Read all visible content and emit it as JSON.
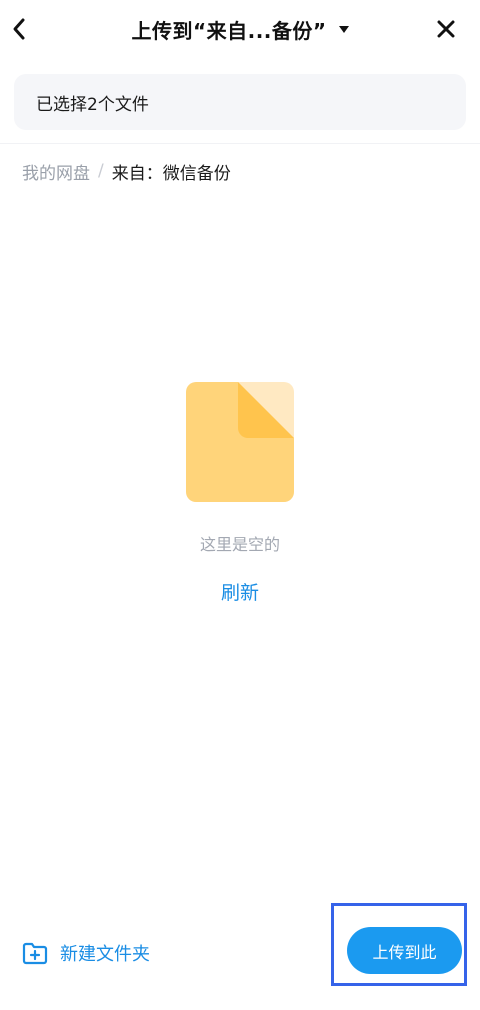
{
  "header": {
    "title": "上传到“来自...备份”",
    "back_icon": "chevron-left-icon",
    "caret_icon": "caret-down-icon",
    "close_icon": "close-icon"
  },
  "selection": {
    "text": "已选择2个文件"
  },
  "breadcrumb": {
    "root": "我的网盘",
    "separator": "/",
    "current": "来自：微信备份"
  },
  "empty_state": {
    "illustration_icon": "empty-file-icon",
    "message": "这里是空的",
    "refresh_label": "刷新"
  },
  "footer": {
    "new_folder_icon": "folder-add-icon",
    "new_folder_label": "新建文件夹",
    "upload_label": "上传到此"
  },
  "colors": {
    "accent": "#1a8de4",
    "button": "#1b9af0",
    "highlight_frame": "#3563e9",
    "file_body": "#ffd47a",
    "file_corner": "#ffc44d"
  }
}
